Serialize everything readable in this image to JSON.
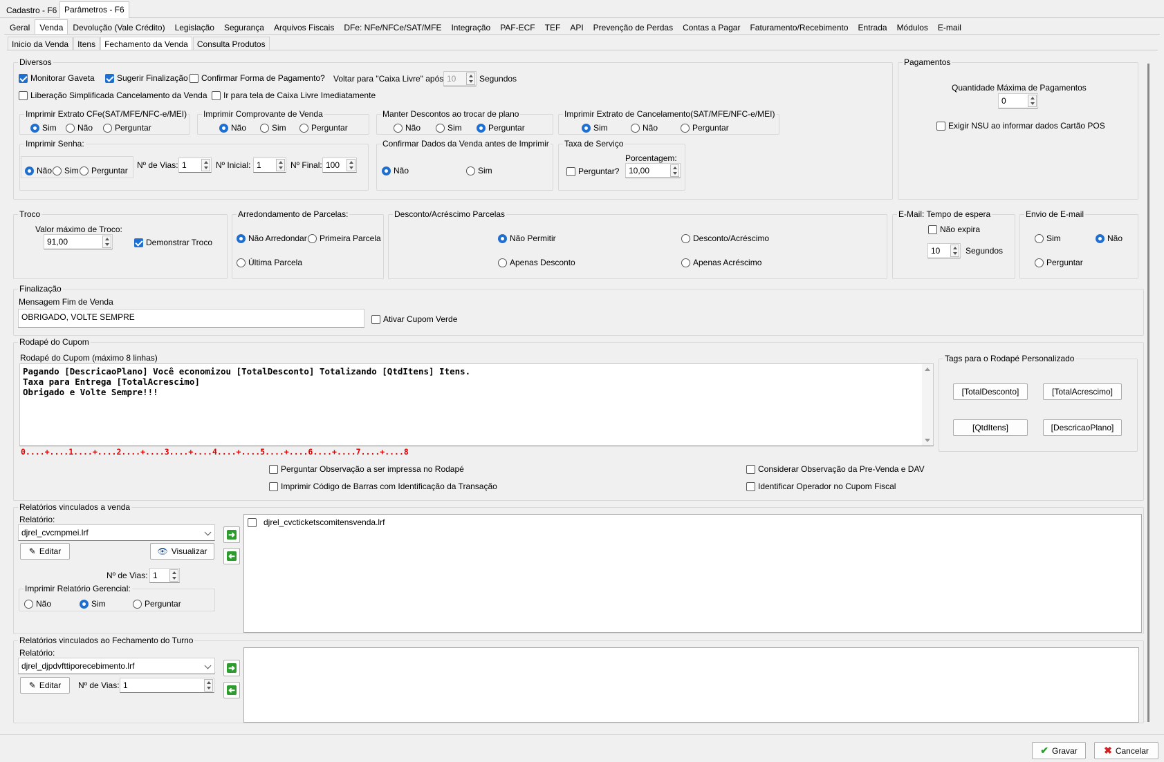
{
  "window_tabs": [
    "Cadastro - F6",
    "Parâmetros - F6"
  ],
  "main_tabs": [
    "Geral",
    "Venda",
    "Devolução (Vale Crédito)",
    "Legislação",
    "Segurança",
    "Arquivos Fiscais",
    "DFe: NFe/NFCe/SAT/MFE",
    "Integração",
    "PAF-ECF",
    "TEF",
    "API",
    "Prevenção de Perdas",
    "Contas a Pagar",
    "Faturamento/Recebimento",
    "Entrada",
    "Módulos",
    "E-mail"
  ],
  "sub_tabs": [
    "Inicio da Venda",
    "Itens",
    "Fechamento da Venda",
    "Consulta Produtos"
  ],
  "diversos": {
    "title": "Diversos",
    "monitorar_gaveta": "Monitorar Gaveta",
    "sugerir_finalizacao": "Sugerir Finalização",
    "confirmar_forma": "Confirmar Forma de Pagamento?",
    "voltar_label": "Voltar para \"Caixa Livre\" após",
    "voltar_value": "10",
    "segundos": "Segundos",
    "liberacao": "Liberação Simplificada Cancelamento da Venda",
    "ir_caixa_livre": "Ir para tela de Caixa Livre Imediatamente",
    "extrato_title": "Imprimir Extrato CFe(SAT/MFE/NFC-e/MEI)",
    "comprovante_title": "Imprimir Comprovante de Venda",
    "descontos_title": "Manter Descontos ao trocar de plano",
    "cancel_title": "Imprimir Extrato de Cancelamento(SAT/MFE/NFC-e/MEI)",
    "sim": "Sim",
    "nao": "Não",
    "perguntar": "Perguntar",
    "senha_title": "Imprimir Senha:",
    "n_vias_label": "Nº de Vias:",
    "n_vias": "1",
    "n_inicial_label": "Nº Inicial:",
    "n_inicial": "1",
    "n_final_label": "Nº Final:",
    "n_final": "100",
    "confirmar_dados_title": "Confirmar Dados da Venda antes de Imprimir",
    "taxa_title": "Taxa de Serviço",
    "perguntar_q": "Perguntar?",
    "porcentagem_label": "Porcentagem:",
    "porcentagem": "10,00"
  },
  "pagamentos": {
    "title": "Pagamentos",
    "qtd_label": "Quantidade Máxima de Pagamentos",
    "qtd": "0",
    "exigir_nsu": "Exigir NSU ao informar dados Cartão POS"
  },
  "troco": {
    "title": "Troco",
    "valor_label": "Valor máximo de Troco:",
    "valor": "91,00",
    "demonstrar": "Demonstrar Troco"
  },
  "arredondamento": {
    "title": "Arredondamento de Parcelas:",
    "nao_arredondar": "Não Arredondar",
    "primeira": "Primeira Parcela",
    "ultima": "Última Parcela"
  },
  "desconto_acrescimo": {
    "title": "Desconto/Acréscimo Parcelas",
    "nao_permitir": "Não Permitir",
    "desc_acresc": "Desconto/Acréscimo",
    "apenas_desconto": "Apenas Desconto",
    "apenas_acrescimo": "Apenas Acréscimo"
  },
  "email_tempo": {
    "title": "E-Mail: Tempo de espera",
    "nao_expira": "Não expira",
    "valor": "10",
    "segundos": "Segundos"
  },
  "envio_email": {
    "title": "Envio de E-mail",
    "sim": "Sim",
    "nao": "Não",
    "perguntar": "Perguntar"
  },
  "finalizacao": {
    "title": "Finalização",
    "mensagem_label": "Mensagem Fim de Venda",
    "mensagem": "OBRIGADO, VOLTE SEMPRE",
    "cupom_verde": "Ativar Cupom Verde"
  },
  "rodape": {
    "title": "Rodapé do Cupom",
    "sub_label": "Rodapé do Cupom (máximo 8 linhas)",
    "lines": [
      "Pagando [DescricaoPlano] Você economizou [TotalDesconto] Totalizando [QtdItens] Itens.",
      "Taxa para Entrega [TotalAcrescimo]",
      "Obrigado e Volte Sempre!!!"
    ],
    "ruler": "0....+....1....+....2....+....3....+....4....+....5....+....6....+....7....+....8",
    "tags_title": "Tags para o Rodapé Personalizado",
    "tags": [
      "[TotalDesconto]",
      "[TotalAcrescimo]",
      "[QtdItens]",
      "[DescricaoPlano]"
    ],
    "perguntar_obs": "Perguntar Observação a ser impressa no Rodapé",
    "imprimir_codigo": "Imprimir Código de Barras com Identificação da Transação",
    "considerar_obs": "Considerar Observação da Pre-Venda e DAV",
    "identificar_operador": "Identificar Operador no Cupom Fiscal"
  },
  "rel_venda": {
    "title": "Relatórios vinculados a venda",
    "relatorio_label": "Relatório:",
    "relatorio": "djrel_cvcmpmei.lrf",
    "editar": "Editar",
    "visualizar": "Visualizar",
    "n_vias_label": "Nº de Vias:",
    "n_vias": "1",
    "gerencial_title": "Imprimir Relatório Gerencial:",
    "nao": "Não",
    "sim": "Sim",
    "perguntar": "Perguntar",
    "list": [
      "djrel_cvcticketscomitensvenda.lrf"
    ]
  },
  "rel_turno": {
    "title": "Relatórios vinculados ao Fechamento do Turno",
    "relatorio_label": "Relatório:",
    "relatorio": "djrel_djpdvfttiporecebimento.lrf",
    "editar": "Editar",
    "n_vias_label": "Nº de Vias:",
    "n_vias": "1"
  },
  "footer": {
    "gravar": "Gravar",
    "cancelar": "Cancelar"
  }
}
